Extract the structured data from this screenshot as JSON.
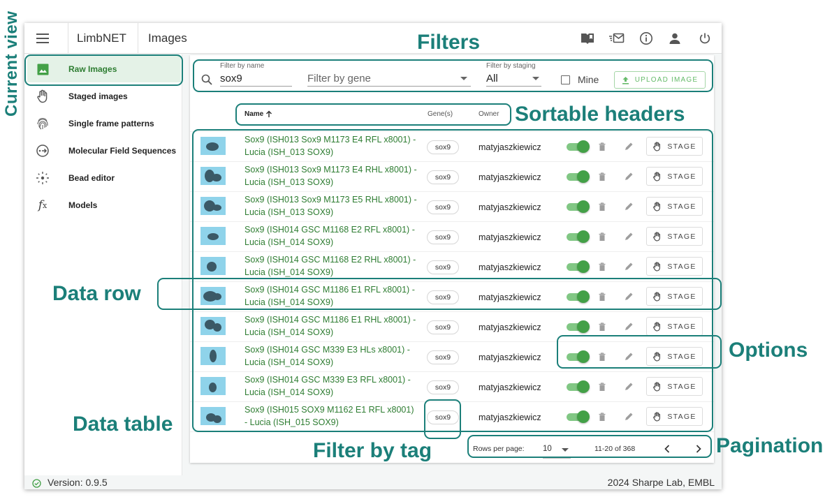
{
  "app": {
    "brand": "LimbNET",
    "page_title": "Images",
    "topbar_icons": [
      "book-icon",
      "inbox-icon",
      "info-icon",
      "account-icon",
      "power-icon"
    ]
  },
  "sidebar": {
    "items": [
      {
        "label": "Raw Images",
        "icon": "image-icon",
        "active": true
      },
      {
        "label": "Staged images",
        "icon": "hand-icon",
        "active": false
      },
      {
        "label": "Single frame patterns",
        "icon": "fingerprint-icon",
        "active": false
      },
      {
        "label": "Molecular Field Sequences",
        "icon": "sequence-icon",
        "active": false
      },
      {
        "label": "Bead editor",
        "icon": "bead-icon",
        "active": false
      },
      {
        "label": "Models",
        "icon": "function-icon",
        "active": false
      }
    ]
  },
  "filters": {
    "name_label": "Filter by name",
    "name_value": "sox9",
    "gene_placeholder": "Filter by gene",
    "staging_label": "Filter by staging",
    "staging_value": "All",
    "mine_label": "Mine",
    "mine_checked": false,
    "upload_label": "UPLOAD IMAGE"
  },
  "table": {
    "headers": {
      "name": "Name",
      "genes": "Gene(s)",
      "owner": "Owner"
    },
    "sort": {
      "column": "name",
      "direction": "ascending"
    },
    "stage_label": "STAGE",
    "rows": [
      {
        "name": "Sox9 (ISH013 Sox9 M1173 E4 RFL x8001) - Lucia (ISH_013 SOX9)",
        "gene": "sox9",
        "owner": "matyjaszkiewicz",
        "enabled": true
      },
      {
        "name": "Sox9 (ISH013 Sox9 M1173 E4 RHL x8001) - Lucia (ISH_013 SOX9)",
        "gene": "sox9",
        "owner": "matyjaszkiewicz",
        "enabled": true
      },
      {
        "name": "Sox9 (ISH013 Sox9 M1173 E5 RHL x8001) - Lucia (ISH_013 SOX9)",
        "gene": "sox9",
        "owner": "matyjaszkiewicz",
        "enabled": true
      },
      {
        "name": "Sox9 (ISH014 GSC M1168 E2 RFL x8001) - Lucia (ISH_014 SOX9)",
        "gene": "sox9",
        "owner": "matyjaszkiewicz",
        "enabled": true
      },
      {
        "name": "Sox9 (ISH014 GSC M1168 E2 RHL x8001) - Lucia (ISH_014 SOX9)",
        "gene": "sox9",
        "owner": "matyjaszkiewicz",
        "enabled": true
      },
      {
        "name": "Sox9 (ISH014 GSC M1186 E1 RFL x8001) - Lucia (ISH_014 SOX9)",
        "gene": "sox9",
        "owner": "matyjaszkiewicz",
        "enabled": true
      },
      {
        "name": "Sox9 (ISH014 GSC M1186 E1 RHL x8001) - Lucia (ISH_014 SOX9)",
        "gene": "sox9",
        "owner": "matyjaszkiewicz",
        "enabled": true
      },
      {
        "name": "Sox9 (ISH014 GSC M339 E3 HLs x8001) - Lucia (ISH_014 SOX9)",
        "gene": "sox9",
        "owner": "matyjaszkiewicz",
        "enabled": true
      },
      {
        "name": "Sox9 (ISH014 GSC M339 E3 RFL x8001) - Lucia (ISH_014 SOX9)",
        "gene": "sox9",
        "owner": "matyjaszkiewicz",
        "enabled": true
      },
      {
        "name": "Sox9 (ISH015 SOX9 M1162 E1 RFL x8001) - Lucia (ISH_015 SOX9)",
        "gene": "sox9",
        "owner": "matyjaszkiewicz",
        "enabled": true
      }
    ]
  },
  "pagination": {
    "rows_label": "Rows per page:",
    "rows_value": "10",
    "range": "11-20 of 368"
  },
  "footer": {
    "version": "Version: 0.9.5",
    "credit": "2024 Sharpe Lab, EMBL"
  },
  "annotations": {
    "current_view": "Current view",
    "filters": "Filters",
    "sortable_headers": "Sortable headers",
    "data_row": "Data row",
    "options": "Options",
    "data_table": "Data table",
    "filter_by_tag": "Filter by tag",
    "pagination": "Pagination"
  },
  "colors": {
    "accent_green": "#2e7d32",
    "toggle_green": "#43a047",
    "annotation_teal": "#1b7f79"
  }
}
